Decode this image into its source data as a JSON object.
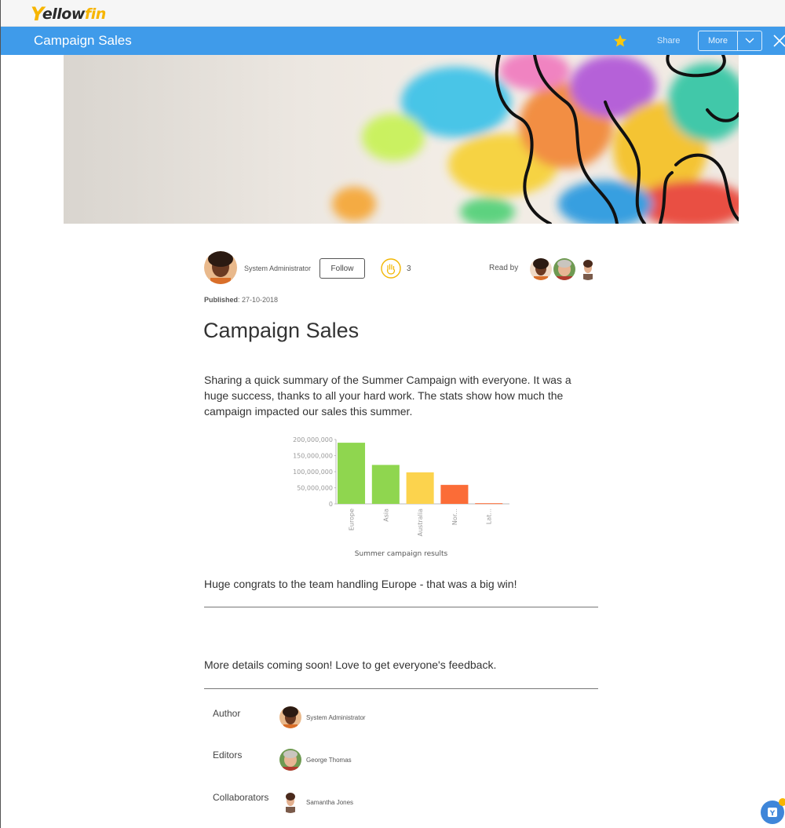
{
  "app": {
    "logo_prefix": "ellow",
    "logo_suffix": "fin",
    "logo_v": "Y"
  },
  "titlebar": {
    "title": "Campaign Sales",
    "share_label": "Share",
    "more_label": "More"
  },
  "post": {
    "author_name": "System Administrator",
    "follow_label": "Follow",
    "clap_count": "3",
    "read_by_label": "Read by",
    "published_label": "Published",
    "published_date": ": 27-10-2018",
    "title": "Campaign Sales",
    "paragraph_1": "Sharing a quick summary of the Summer Campaign with everyone. It was a huge success, thanks to all your hard work. The stats show how much the campaign impacted our sales this summer.",
    "paragraph_2": "Huge congrats to the team handling Europe - that was a big win!",
    "paragraph_3": "More details coming soon! Love to get everyone's feedback."
  },
  "chart_data": {
    "type": "bar",
    "title": "Summer campaign results",
    "categories": [
      "Europe",
      "Asia",
      "Australia",
      "Nor...",
      "Lat..."
    ],
    "values": [
      190000000,
      121000000,
      98000000,
      59000000,
      2000000
    ],
    "colors": [
      "#8fd64f",
      "#8fd64f",
      "#fcd34d",
      "#fb6c37",
      "#fb6c37"
    ],
    "yticks": [
      "0",
      "50,000,000",
      "100,000,000",
      "150,000,000",
      "200,000,000"
    ],
    "ylim": [
      0,
      200000000
    ],
    "grid": false
  },
  "credits": {
    "author_label": "Author",
    "author_name": "System Administrator",
    "editors_label": "Editors",
    "editor_name": "George Thomas",
    "collaborators_label": "Collaborators",
    "collaborator_name": "Samantha Jones"
  },
  "colors": {
    "accent": "#3f9bea",
    "brand_yellow": "#f7b500"
  },
  "icons": {
    "star": "star-icon",
    "close": "close-icon",
    "chevron": "chevron-down-icon",
    "clap": "clap-icon",
    "help": "yellowfin-help-icon"
  }
}
